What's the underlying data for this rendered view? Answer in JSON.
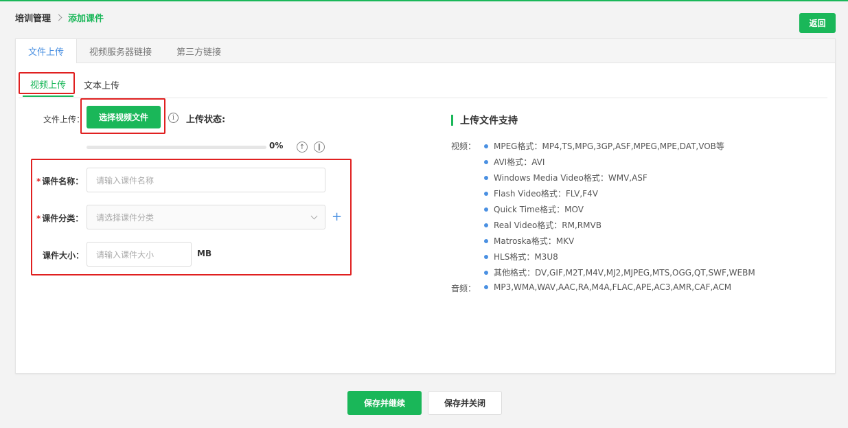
{
  "breadcrumb": {
    "root": "培训管理",
    "current": "添加课件"
  },
  "back_label": "返回",
  "top_tabs": [
    {
      "label": "文件上传",
      "active": true
    },
    {
      "label": "视频服务器链接",
      "active": false
    },
    {
      "label": "第三方链接",
      "active": false
    }
  ],
  "sub_tabs": [
    {
      "label": "视频上传",
      "active": true
    },
    {
      "label": "文本上传",
      "active": false
    }
  ],
  "upload": {
    "label": "文件上传：",
    "select_button": "选择视频文件",
    "info_icon": "ⓘ",
    "status_label": "上传状态:",
    "progress_fraction": 0,
    "progress_text": "0%"
  },
  "form": {
    "name_label": "课件名称：",
    "name_placeholder": "请输入课件名称",
    "category_label": "课件分类：",
    "category_placeholder": "请选择课件分类",
    "size_label": "课件大小：",
    "size_placeholder": "请输入课件大小",
    "size_unit": "MB",
    "add_category_icon": "+"
  },
  "support": {
    "title": "上传文件支持",
    "video_label": "视频：",
    "video_formats": [
      "MPEG格式：MP4,TS,MPG,3GP,ASF,MPEG,MPE,DAT,VOB等",
      "AVI格式：AVI",
      "Windows Media Video格式：WMV,ASF",
      "Flash Video格式：FLV,F4V",
      "Quick Time格式：MOV",
      "Real Video格式：RM,RMVB",
      "Matroska格式：MKV",
      "HLS格式：M3U8",
      "其他格式：DV,GIF,M2T,M4V,MJ2,MJPEG,MTS,OGG,QT,SWF,WEBM"
    ],
    "audio_label": "音频：",
    "audio_formats": "MP3,WMA,WAV,AAC,RA,M4A,FLAC,APE,AC3,AMR,CAF,ACM"
  },
  "buttons": {
    "save_continue": "保存并继续",
    "save_close": "保存并关闭"
  },
  "colors": {
    "brand_green": "#1ab759",
    "accent_blue": "#4a90e2",
    "highlight_red": "#e02020"
  }
}
